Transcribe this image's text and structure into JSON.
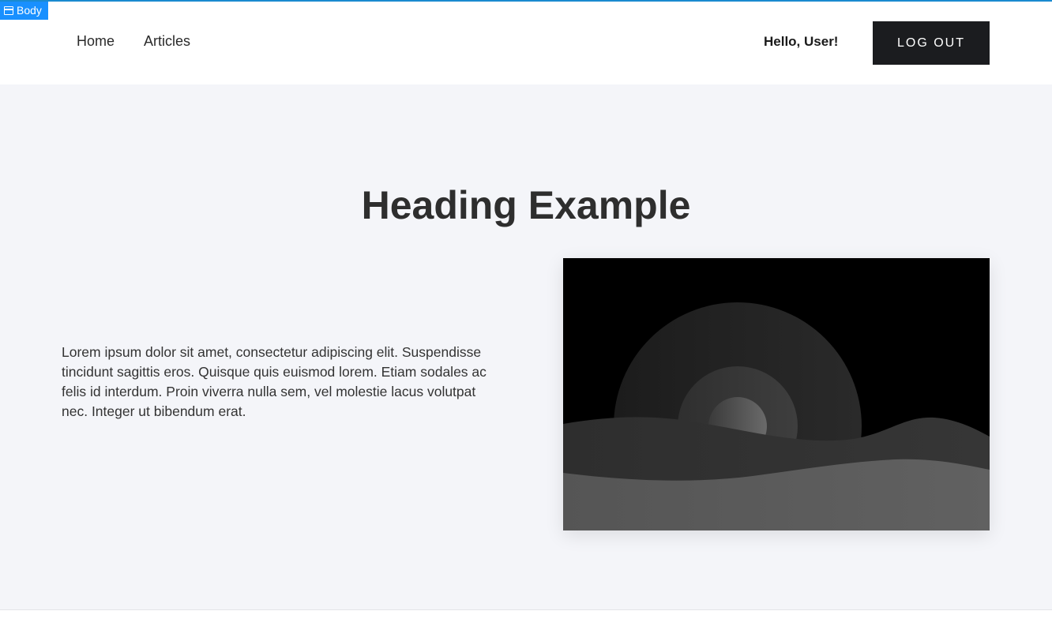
{
  "devtools": {
    "element_tag": "Body",
    "tag_icon": "window-icon"
  },
  "nav": {
    "links": [
      {
        "label": "Home"
      },
      {
        "label": "Articles"
      }
    ],
    "greeting": "Hello, User!",
    "logout_label": "LOG OUT"
  },
  "hero": {
    "title": "Heading Example",
    "body": "Lorem ipsum dolor sit amet, consectetur adipiscing elit. Suspendisse tincidunt sagittis eros. Quisque quis euismod lorem. Etiam sodales ac felis id interdum. Proin viverra nulla sem, vel molestie lacus volutpat nec. Integer ut bibendum erat.",
    "image_icon": "landscape-placeholder-icon"
  },
  "colors": {
    "accent_blue": "#1890ff",
    "button_dark": "#1b1c1f",
    "hero_bg": "#f4f5f9"
  }
}
